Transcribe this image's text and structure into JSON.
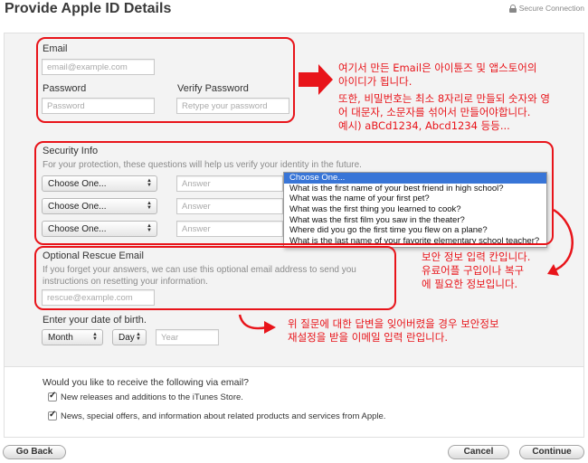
{
  "header": {
    "title": "Provide Apple ID Details",
    "secure_label": "Secure Connection"
  },
  "account": {
    "email_label": "Email",
    "email_placeholder": "email@example.com",
    "password_label": "Password",
    "password_placeholder": "Password",
    "verify_label": "Verify Password",
    "verify_placeholder": "Retype your password"
  },
  "security": {
    "heading": "Security Info",
    "hint": "For your protection, these questions will help us verify your identity in the future.",
    "question_selects": [
      "Choose One...",
      "Choose One...",
      "Choose One..."
    ],
    "answer_placeholder": "Answer",
    "dropdown_options": [
      "Choose One...",
      "What is the first name of your best friend in high school?",
      "What was the name of your first pet?",
      "What was the first thing you learned to cook?",
      "What was the first film you saw in the theater?",
      "Where did you go the first time you flew on a plane?",
      "What is the last name of your favorite elementary school teacher?"
    ]
  },
  "rescue": {
    "heading": "Optional Rescue Email",
    "hint": "If you forget your answers, we can use this optional email address to send you instructions on resetting your information.",
    "placeholder": "rescue@example.com"
  },
  "birth": {
    "label": "Enter your date of birth.",
    "month": "Month",
    "day": "Day",
    "year_placeholder": "Year"
  },
  "newsletter": {
    "question": "Would you like to receive the following via email?",
    "option1": "New releases and additions to the iTunes Store.",
    "option2": "News, special offers, and information about related products and services from Apple."
  },
  "buttons": {
    "back": "Go Back",
    "cancel": "Cancel",
    "continue": "Continue"
  },
  "annotations": {
    "email_note_line1": "여기서 만든 Email은 아이튠즈 및 앱스토어의",
    "email_note_line2": "아이디가 됩니다.",
    "password_note_line1": "또한, 비밀번호는 최소 8자리로 만들되 숫자와 영",
    "password_note_line2": "어 대문자, 소문자를 섞어서 만들어야합니다.",
    "password_note_line3": "예시) aBCd1234, Abcd1234 등등...",
    "security_note_line1": "보안 정보 입력 칸입니다.",
    "security_note_line2": "유료어플 구입이나 복구",
    "security_note_line3": "에 필요한 정보입니다.",
    "rescue_note_line1": "위 질문에 대한 답변을 잊어버렸을 경우 보안정보",
    "rescue_note_line2": "재설정을 받을 이메일 입력 란입니다.",
    "accent_color": "#e8141a"
  }
}
